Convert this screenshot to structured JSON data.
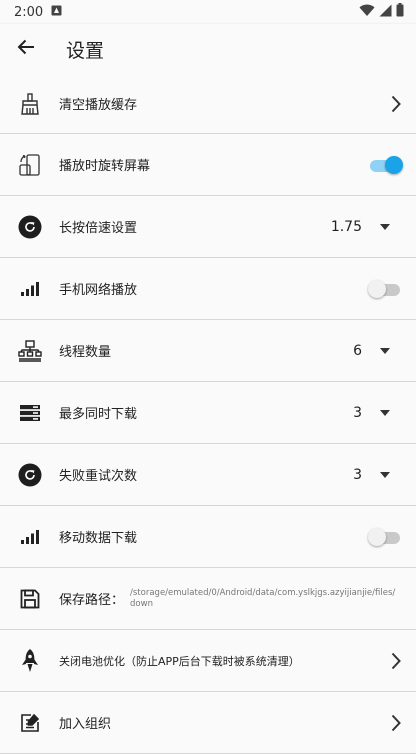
{
  "statusbar": {
    "time": "2:00"
  },
  "appbar": {
    "title": "设置"
  },
  "rows": {
    "clear_cache": {
      "label": "清空播放缓存"
    },
    "rotate": {
      "label": "播放时旋转屏幕",
      "enabled": true
    },
    "speed": {
      "label": "长按倍速设置",
      "value": "1.75"
    },
    "mobile_play": {
      "label": "手机网络播放",
      "enabled": false
    },
    "threads": {
      "label": "线程数量",
      "value": "6"
    },
    "max_downloads": {
      "label": "最多同时下载",
      "value": "3"
    },
    "retries": {
      "label": "失败重试次数",
      "value": "3"
    },
    "mobile_download": {
      "label": "移动数据下载",
      "enabled": false
    },
    "save_path": {
      "label": "保存路径：",
      "value": "/storage/emulated/0/Android/data/com.yslkjgs.azyijianjie/files/down"
    },
    "battery": {
      "label": "关闭电池优化（防止APP后台下载时被系统清理）"
    },
    "join_org": {
      "label": "加入组织"
    }
  },
  "colors": {
    "accent": "#1aa3e8",
    "divider": "#d6d6d6",
    "background": "#fafafa"
  }
}
